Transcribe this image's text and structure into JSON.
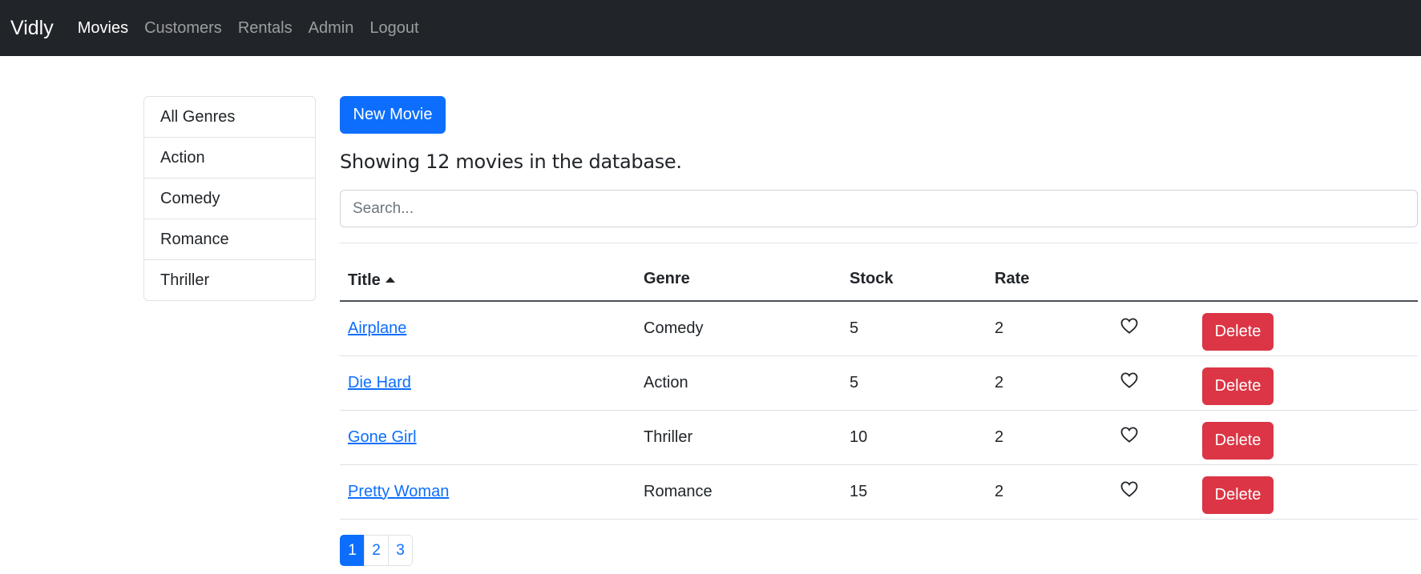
{
  "navbar": {
    "brand": "Vidly",
    "links": [
      "Movies",
      "Customers",
      "Rentals",
      "Admin",
      "Logout"
    ],
    "active": "Movies"
  },
  "sidebar": {
    "genres": [
      "All Genres",
      "Action",
      "Comedy",
      "Romance",
      "Thriller"
    ]
  },
  "main": {
    "new_movie_label": "New Movie",
    "count_text": "Showing 12 movies in the database.",
    "search_placeholder": "Search...",
    "table": {
      "headers": [
        "Title",
        "Genre",
        "Stock",
        "Rate"
      ],
      "sorted_column": "Title",
      "sort_direction": "asc",
      "delete_label": "Delete",
      "rows": [
        {
          "title": "Airplane",
          "genre": "Comedy",
          "stock": "5",
          "rate": "2"
        },
        {
          "title": "Die Hard",
          "genre": "Action",
          "stock": "5",
          "rate": "2"
        },
        {
          "title": "Gone Girl",
          "genre": "Thriller",
          "stock": "10",
          "rate": "2"
        },
        {
          "title": "Pretty Woman",
          "genre": "Romance",
          "stock": "15",
          "rate": "2"
        }
      ]
    },
    "pagination": {
      "pages": [
        "1",
        "2",
        "3"
      ],
      "current": "1"
    }
  },
  "colors": {
    "navbar_bg": "#212529",
    "primary": "#0d6efd",
    "danger": "#dc3545"
  },
  "icons": {
    "sort": "caret-up-icon",
    "like": "heart-outline-icon"
  }
}
